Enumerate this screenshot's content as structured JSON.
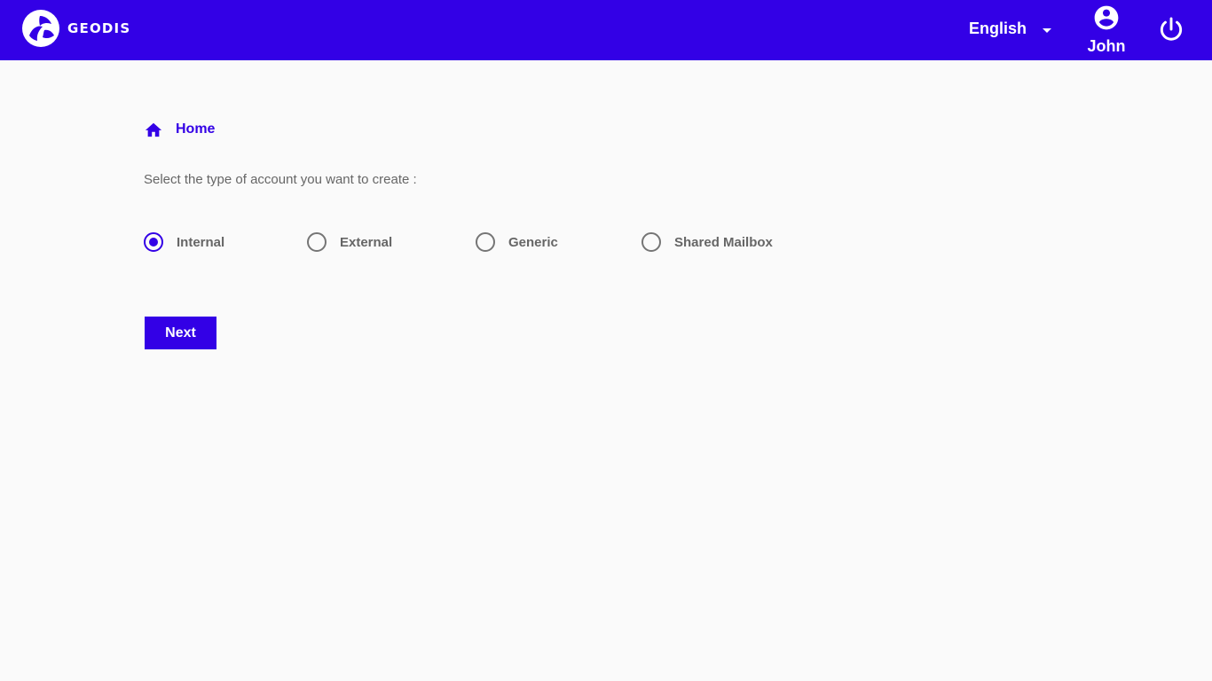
{
  "header": {
    "logo_text": "GEODIS",
    "language": "English",
    "user_name": "John",
    "background_color": "#3300e6",
    "icons": {
      "logo": "geodis-logo-icon",
      "language_dropdown": "caret-down-icon",
      "user": "account-circle-icon",
      "power": "power-icon"
    }
  },
  "breadcrumb": {
    "label": "Home",
    "icon": "home-icon"
  },
  "form": {
    "prompt": "Select the type of account you want to create :",
    "options": [
      {
        "label": "Internal",
        "selected": true
      },
      {
        "label": "External",
        "selected": false
      },
      {
        "label": "Generic",
        "selected": false
      },
      {
        "label": "Shared Mailbox",
        "selected": false
      }
    ],
    "next_label": "Next",
    "accent_color": "#3300e6"
  }
}
